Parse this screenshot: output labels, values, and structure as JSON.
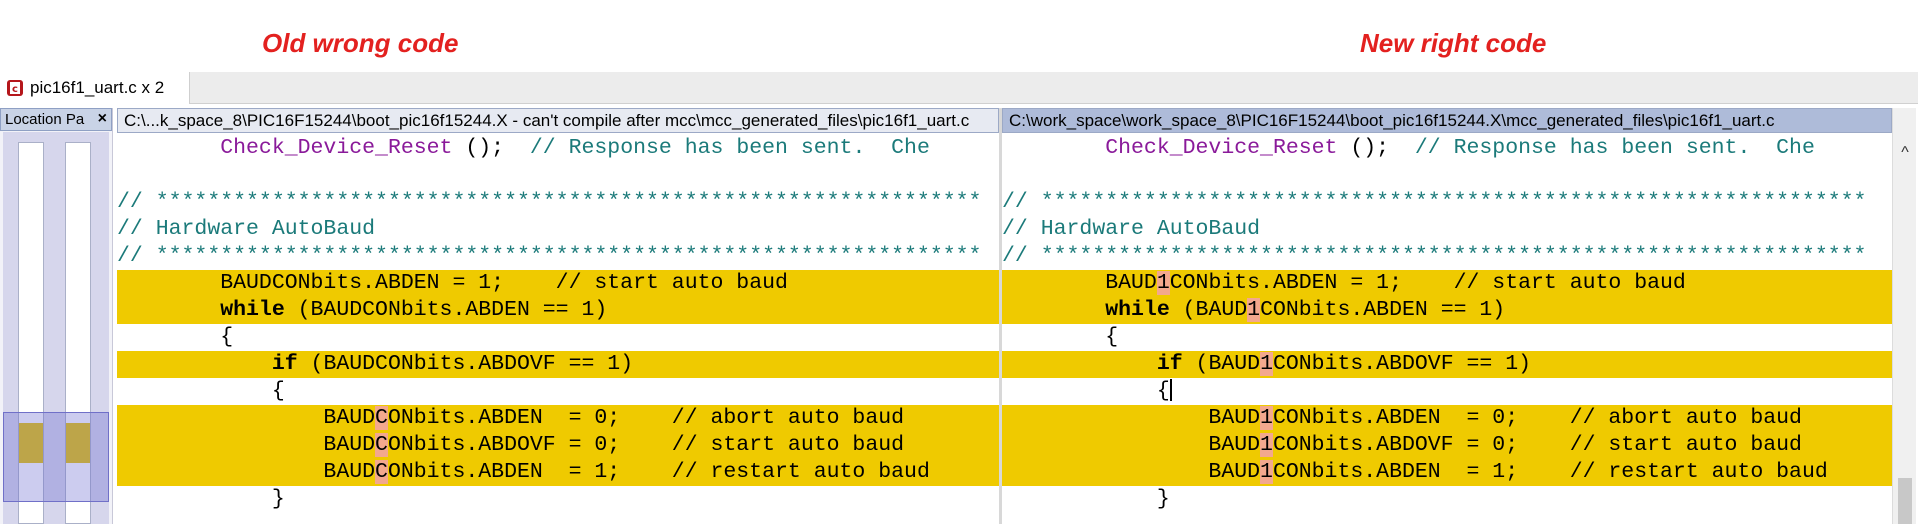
{
  "annotations": {
    "left": "Old wrong code",
    "right": "New right code"
  },
  "file_tab": {
    "label": "pic16f1_uart.c x 2",
    "icon": "c-source-file-icon"
  },
  "location_panel": {
    "title": "Location Pa",
    "close_label": "×"
  },
  "left_pane": {
    "title": "C:\\...k_space_8\\PIC16F15244\\boot_pic16f15244.X - can't compile after mcc\\mcc_generated_files\\pic16f1_uart.c",
    "lines": {
      "l1_indent": "        ",
      "l1_func": "Check_Device_Reset",
      "l1_rest": " ();  ",
      "l1_comment": "// Response has been sent.  Che",
      "l3": "// ****************************************************************",
      "l4": "// Hardware AutoBaud",
      "l5": "// ****************************************************************",
      "l6": "        BAUDCONbits.ABDEN = 1;    // start auto baud",
      "l7_indent": "        ",
      "l7_kw": "while",
      "l7_rest": " (BAUDCONbits.ABDEN == 1)",
      "l8": "        {",
      "l9_indent": "            ",
      "l9_kw": "if",
      "l9_rest": " (BAUDCONbits.ABDOVF == 1)",
      "l10": "            {",
      "l11_a": "                BAUD",
      "l11_b": "C",
      "l11_c": "ONbits.ABDEN  = 0;    // abort auto baud",
      "l12_a": "                BAUD",
      "l12_b": "C",
      "l12_c": "ONbits.ABDOVF = 0;    // start auto baud",
      "l13_a": "                BAUD",
      "l13_b": "C",
      "l13_c": "ONbits.ABDEN  = 1;    // restart auto baud",
      "l14": "            }"
    }
  },
  "right_pane": {
    "title": "C:\\work_space\\work_space_8\\PIC16F15244\\boot_pic16f15244.X\\mcc_generated_files\\pic16f1_uart.c",
    "lines": {
      "l1_indent": "        ",
      "l1_func": "Check_Device_Reset",
      "l1_rest": " ();  ",
      "l1_comment": "// Response has been sent.  Che",
      "l3": "// ****************************************************************",
      "l4": "// Hardware AutoBaud",
      "l5": "// ****************************************************************",
      "l6_a": "        BAUD",
      "l6_b": "1",
      "l6_c": "CONbits.ABDEN = 1;    // start auto baud",
      "l7_indent": "        ",
      "l7_kw": "while",
      "l7_a": " (BAUD",
      "l7_b": "1",
      "l7_c": "CONbits.ABDEN == 1)",
      "l8": "        {",
      "l9_indent": "            ",
      "l9_kw": "if",
      "l9_a": " (BAUD",
      "l9_b": "1",
      "l9_c": "CONbits.ABDOVF == 1)",
      "l10": "            {",
      "l11_a": "                BAUD",
      "l11_b": "1",
      "l11_c": "CONbits.ABDEN  = 0;    // abort auto baud",
      "l12_a": "                BAUD",
      "l12_b": "1",
      "l12_c": "CONbits.ABDOVF = 0;    // start auto baud",
      "l13_a": "                BAUD",
      "l13_b": "1",
      "l13_c": "CONbits.ABDEN  = 1;    // restart auto baud",
      "l14": "            }"
    }
  },
  "scrollbar": {
    "up_arrow": "^"
  },
  "colors": {
    "diff_highlight": "#efca00",
    "char_change": "#f3a88e",
    "annotation": "#e3211f",
    "comment": "#1b7a7a",
    "function": "#8a1a9a"
  }
}
